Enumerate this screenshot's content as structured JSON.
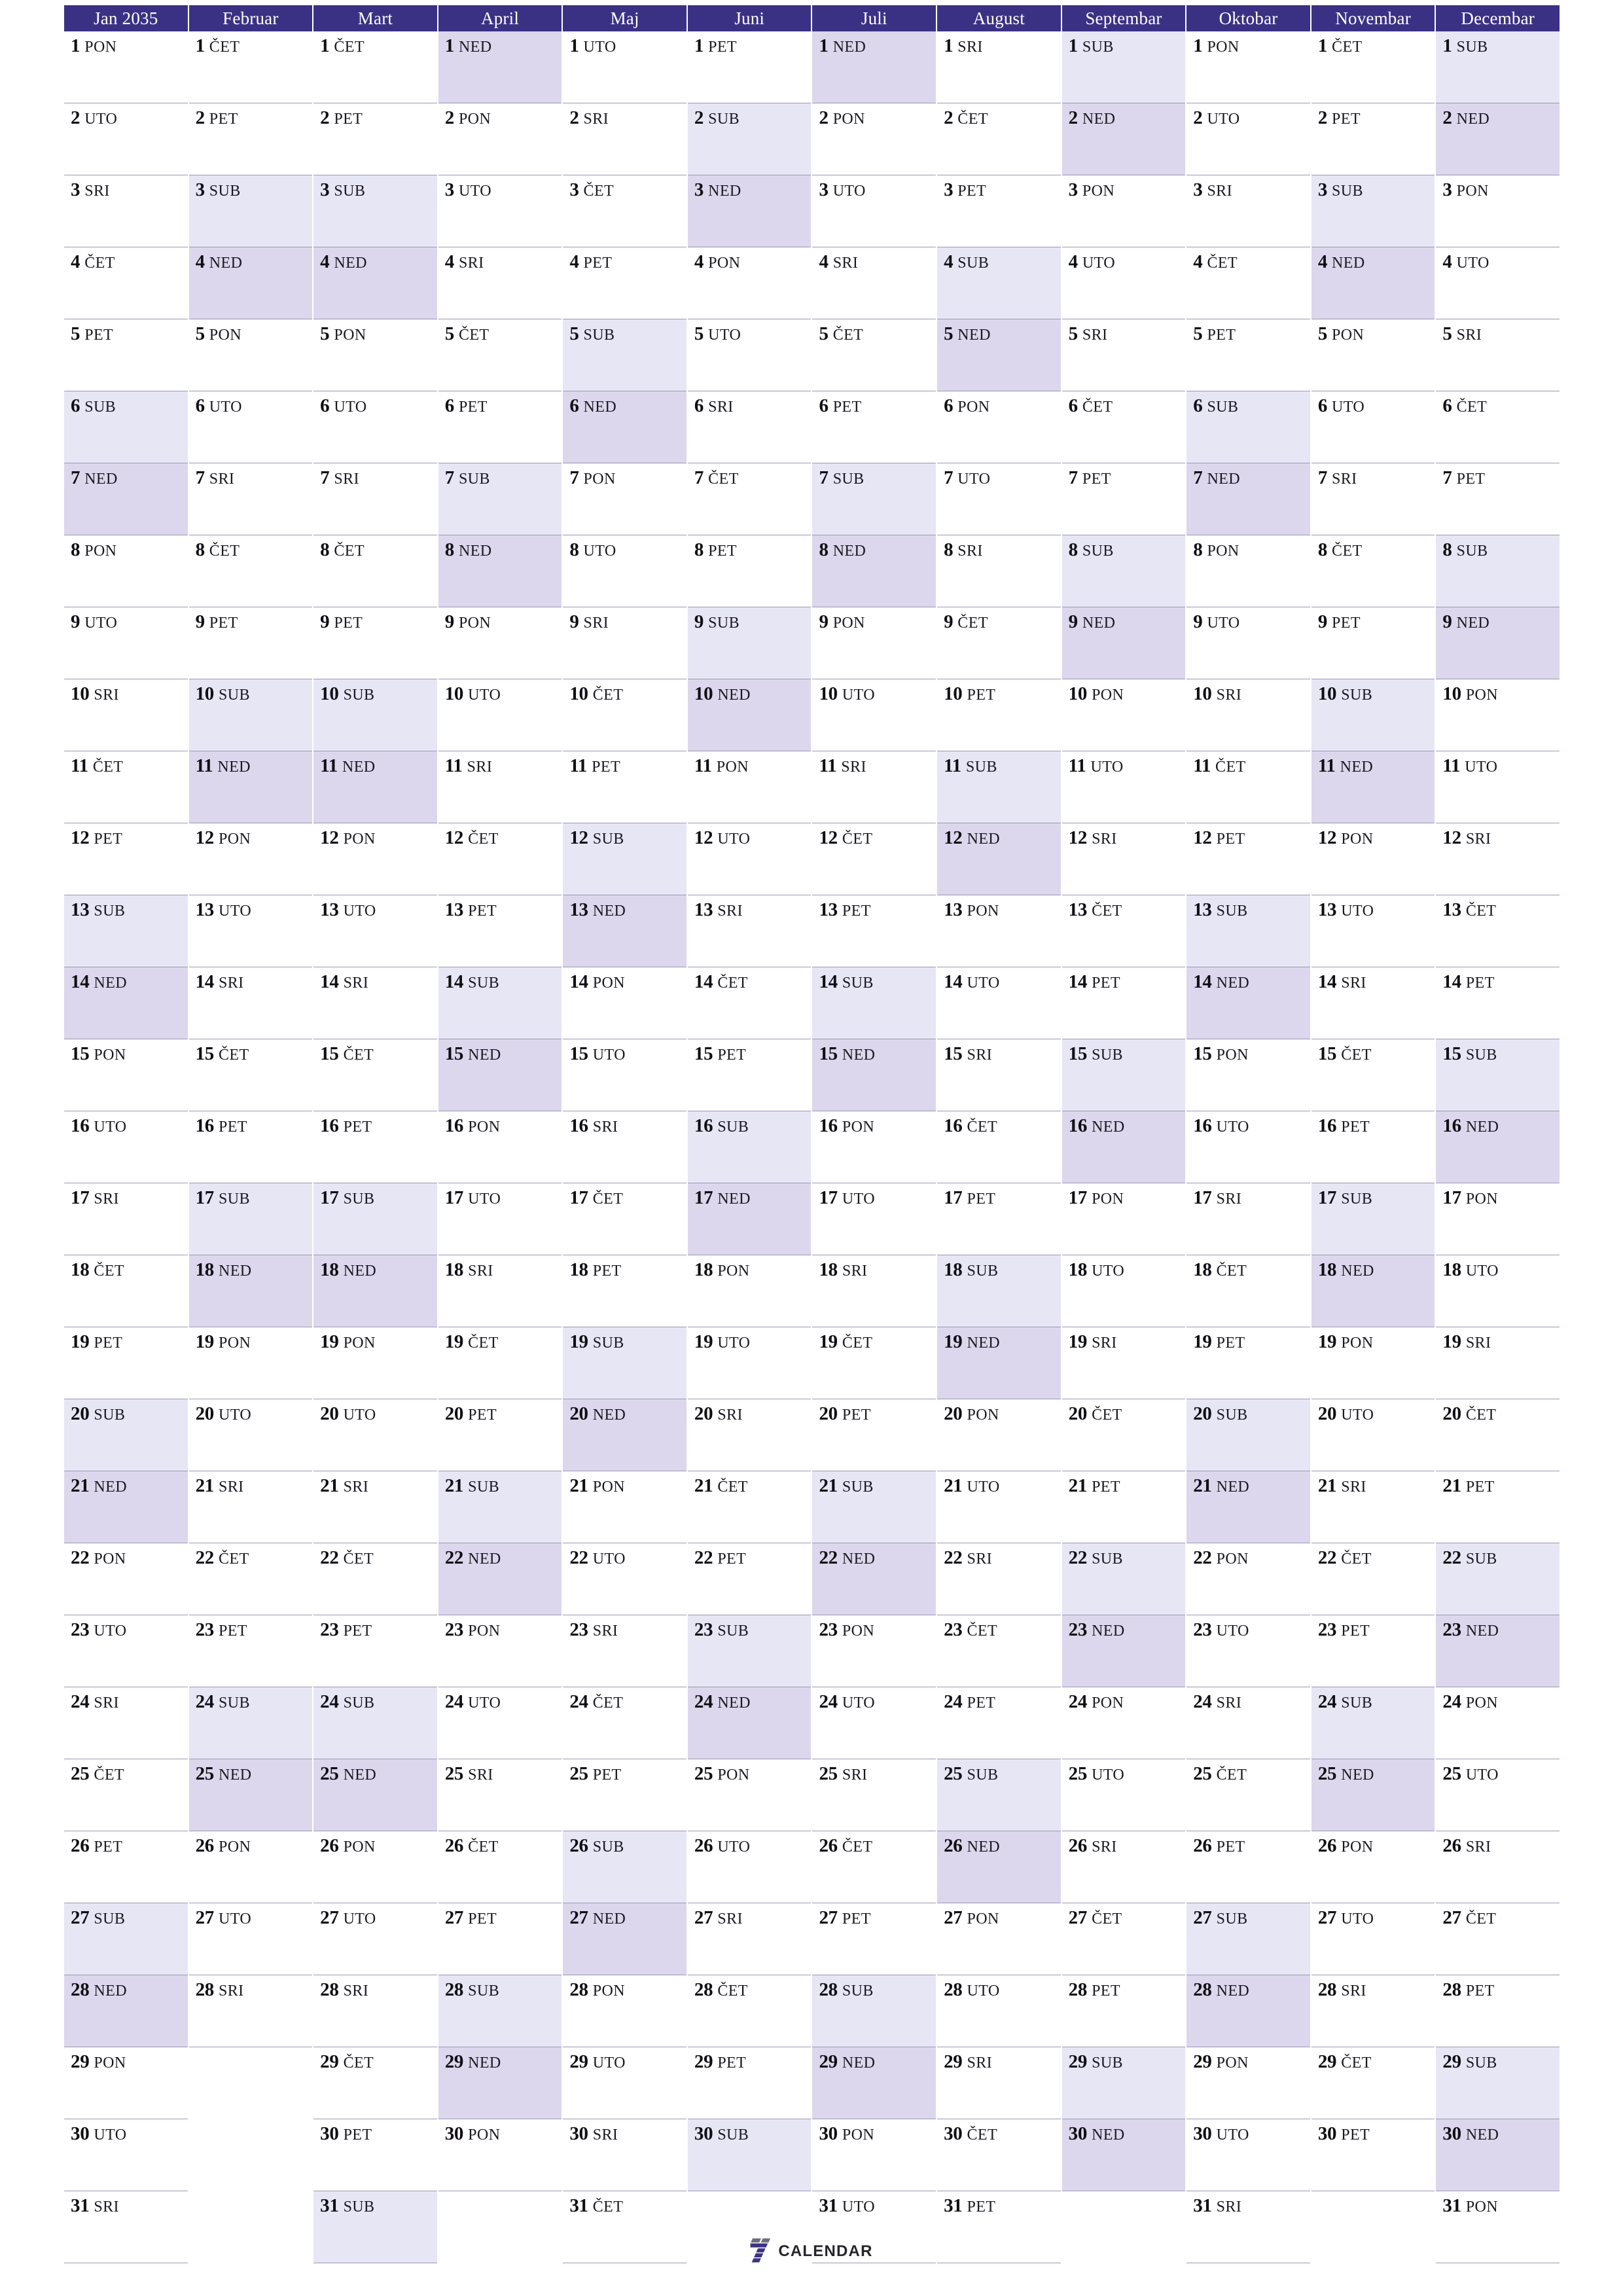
{
  "document": {
    "type": "year-planner",
    "year": "2035",
    "locale_weekdays": [
      "PON",
      "UTO",
      "SRI",
      "ČET",
      "PET",
      "SUB",
      "NED"
    ],
    "rows": 31
  },
  "colors": {
    "header_bg": "#3b3184",
    "header_text": "#ffffff",
    "saturday_bg": "#e6e6f5",
    "sunday_bg": "#dcd7ec",
    "weekday_bg": "#ffffff",
    "rule": "#9d97b5",
    "logo_accent": "#3b3184",
    "logo_gray": "#6f6f7a",
    "text": "#100e14"
  },
  "footer": {
    "logo_mark": "seven-logo-icon",
    "logo_text": "CALENDAR"
  },
  "months": [
    {
      "name": "Jan 2035",
      "days": 31,
      "first_weekday": "PON",
      "weekdays": [
        "PON",
        "UTO",
        "SRI",
        "ČET",
        "PET",
        "SUB",
        "NED",
        "PON",
        "UTO",
        "SRI",
        "ČET",
        "PET",
        "SUB",
        "NED",
        "PON",
        "UTO",
        "SRI",
        "ČET",
        "PET",
        "SUB",
        "NED",
        "PON",
        "UTO",
        "SRI",
        "ČET",
        "PET",
        "SUB",
        "NED",
        "PON",
        "UTO",
        "SRI"
      ]
    },
    {
      "name": "Februar",
      "days": 28,
      "first_weekday": "ČET",
      "weekdays": [
        "ČET",
        "PET",
        "SUB",
        "NED",
        "PON",
        "UTO",
        "SRI",
        "ČET",
        "PET",
        "SUB",
        "NED",
        "PON",
        "UTO",
        "SRI",
        "ČET",
        "PET",
        "SUB",
        "NED",
        "PON",
        "UTO",
        "SRI",
        "ČET",
        "PET",
        "SUB",
        "NED",
        "PON",
        "UTO",
        "SRI"
      ]
    },
    {
      "name": "Mart",
      "days": 31,
      "first_weekday": "ČET",
      "weekdays": [
        "ČET",
        "PET",
        "SUB",
        "NED",
        "PON",
        "UTO",
        "SRI",
        "ČET",
        "PET",
        "SUB",
        "NED",
        "PON",
        "UTO",
        "SRI",
        "ČET",
        "PET",
        "SUB",
        "NED",
        "PON",
        "UTO",
        "SRI",
        "ČET",
        "PET",
        "SUB",
        "NED",
        "PON",
        "UTO",
        "SRI",
        "ČET",
        "PET",
        "SUB"
      ]
    },
    {
      "name": "April",
      "days": 30,
      "first_weekday": "NED",
      "weekdays": [
        "NED",
        "PON",
        "UTO",
        "SRI",
        "ČET",
        "PET",
        "SUB",
        "NED",
        "PON",
        "UTO",
        "SRI",
        "ČET",
        "PET",
        "SUB",
        "NED",
        "PON",
        "UTO",
        "SRI",
        "ČET",
        "PET",
        "SUB",
        "NED",
        "PON",
        "UTO",
        "SRI",
        "ČET",
        "PET",
        "SUB",
        "NED",
        "PON"
      ]
    },
    {
      "name": "Maj",
      "days": 31,
      "first_weekday": "UTO",
      "weekdays": [
        "UTO",
        "SRI",
        "ČET",
        "PET",
        "SUB",
        "NED",
        "PON",
        "UTO",
        "SRI",
        "ČET",
        "PET",
        "SUB",
        "NED",
        "PON",
        "UTO",
        "SRI",
        "ČET",
        "PET",
        "SUB",
        "NED",
        "PON",
        "UTO",
        "SRI",
        "ČET",
        "PET",
        "SUB",
        "NED",
        "PON",
        "UTO",
        "SRI",
        "ČET"
      ]
    },
    {
      "name": "Juni",
      "days": 30,
      "first_weekday": "PET",
      "weekdays": [
        "PET",
        "SUB",
        "NED",
        "PON",
        "UTO",
        "SRI",
        "ČET",
        "PET",
        "SUB",
        "NED",
        "PON",
        "UTO",
        "SRI",
        "ČET",
        "PET",
        "SUB",
        "NED",
        "PON",
        "UTO",
        "SRI",
        "ČET",
        "PET",
        "SUB",
        "NED",
        "PON",
        "UTO",
        "SRI",
        "ČET",
        "PET",
        "SUB"
      ]
    },
    {
      "name": "Juli",
      "days": 31,
      "first_weekday": "NED",
      "weekdays": [
        "NED",
        "PON",
        "UTO",
        "SRI",
        "ČET",
        "PET",
        "SUB",
        "NED",
        "PON",
        "UTO",
        "SRI",
        "ČET",
        "PET",
        "SUB",
        "NED",
        "PON",
        "UTO",
        "SRI",
        "ČET",
        "PET",
        "SUB",
        "NED",
        "PON",
        "UTO",
        "SRI",
        "ČET",
        "PET",
        "SUB",
        "NED",
        "PON",
        "UTO"
      ]
    },
    {
      "name": "August",
      "days": 31,
      "first_weekday": "SRI",
      "weekdays": [
        "SRI",
        "ČET",
        "PET",
        "SUB",
        "NED",
        "PON",
        "UTO",
        "SRI",
        "ČET",
        "PET",
        "SUB",
        "NED",
        "PON",
        "UTO",
        "SRI",
        "ČET",
        "PET",
        "SUB",
        "NED",
        "PON",
        "UTO",
        "SRI",
        "ČET",
        "PET",
        "SUB",
        "NED",
        "PON",
        "UTO",
        "SRI",
        "ČET",
        "PET"
      ]
    },
    {
      "name": "Septembar",
      "days": 30,
      "first_weekday": "SUB",
      "weekdays": [
        "SUB",
        "NED",
        "PON",
        "UTO",
        "SRI",
        "ČET",
        "PET",
        "SUB",
        "NED",
        "PON",
        "UTO",
        "SRI",
        "ČET",
        "PET",
        "SUB",
        "NED",
        "PON",
        "UTO",
        "SRI",
        "ČET",
        "PET",
        "SUB",
        "NED",
        "PON",
        "UTO",
        "SRI",
        "ČET",
        "PET",
        "SUB",
        "NED"
      ]
    },
    {
      "name": "Oktobar",
      "days": 31,
      "first_weekday": "PON",
      "weekdays": [
        "PON",
        "UTO",
        "SRI",
        "ČET",
        "PET",
        "SUB",
        "NED",
        "PON",
        "UTO",
        "SRI",
        "ČET",
        "PET",
        "SUB",
        "NED",
        "PON",
        "UTO",
        "SRI",
        "ČET",
        "PET",
        "SUB",
        "NED",
        "PON",
        "UTO",
        "SRI",
        "ČET",
        "PET",
        "SUB",
        "NED",
        "PON",
        "UTO",
        "SRI"
      ]
    },
    {
      "name": "Novembar",
      "days": 30,
      "first_weekday": "ČET",
      "weekdays": [
        "ČET",
        "PET",
        "SUB",
        "NED",
        "PON",
        "UTO",
        "SRI",
        "ČET",
        "PET",
        "SUB",
        "NED",
        "PON",
        "UTO",
        "SRI",
        "ČET",
        "PET",
        "SUB",
        "NED",
        "PON",
        "UTO",
        "SRI",
        "ČET",
        "PET",
        "SUB",
        "NED",
        "PON",
        "UTO",
        "SRI",
        "ČET",
        "PET"
      ]
    },
    {
      "name": "Decembar",
      "days": 31,
      "first_weekday": "SUB",
      "weekdays": [
        "SUB",
        "NED",
        "PON",
        "UTO",
        "SRI",
        "ČET",
        "PET",
        "SUB",
        "NED",
        "PON",
        "UTO",
        "SRI",
        "ČET",
        "PET",
        "SUB",
        "NED",
        "PON",
        "UTO",
        "SRI",
        "ČET",
        "PET",
        "SUB",
        "NED",
        "PON",
        "UTO",
        "SRI",
        "ČET",
        "PET",
        "SUB",
        "NED",
        "PON"
      ]
    }
  ]
}
